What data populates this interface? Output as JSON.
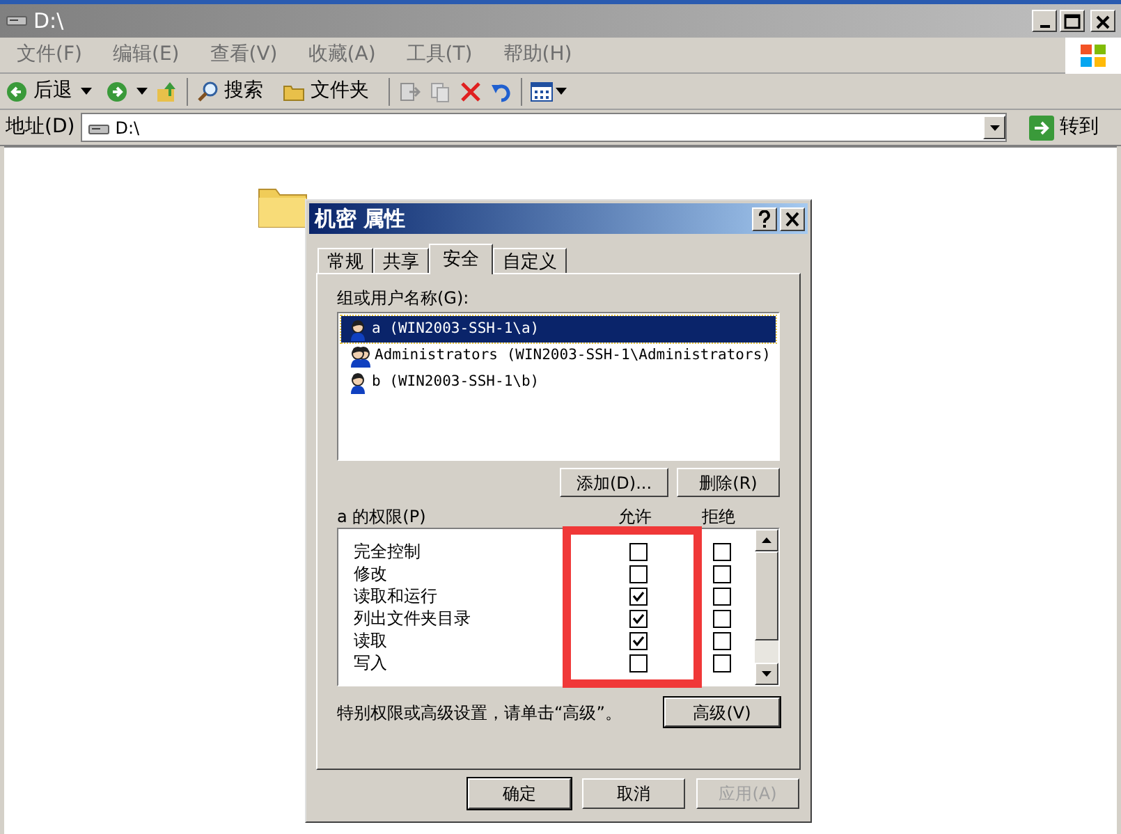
{
  "window": {
    "title": "D:\\"
  },
  "menu": [
    "文件(F)",
    "编辑(E)",
    "查看(V)",
    "收藏(A)",
    "工具(T)",
    "帮助(H)"
  ],
  "toolbar": {
    "back": "后退",
    "search": "搜索",
    "folders": "文件夹"
  },
  "address": {
    "label": "地址(D)",
    "value": "D:\\",
    "go": "转到"
  },
  "dialog": {
    "title": "机密 属性",
    "tabs": [
      {
        "label": "常规",
        "selected": false
      },
      {
        "label": "共享",
        "selected": false
      },
      {
        "label": "安全",
        "selected": true
      },
      {
        "label": "自定义",
        "selected": false
      }
    ],
    "users_label": "组或用户名称(G):",
    "users": [
      {
        "name": "a (WIN2003-SSH-1\\a)",
        "kind": "user",
        "selected": true
      },
      {
        "name": "Administrators (WIN2003-SSH-1\\Administrators)",
        "kind": "group",
        "selected": false
      },
      {
        "name": "b (WIN2003-SSH-1\\b)",
        "kind": "user",
        "selected": false
      }
    ],
    "add_button": "添加(D)...",
    "remove_button": "删除(R)",
    "permissions_label": "a 的权限(P)",
    "allow_header": "允许",
    "deny_header": "拒绝",
    "permissions": [
      {
        "name": "完全控制",
        "allow": false,
        "deny": false
      },
      {
        "name": "修改",
        "allow": false,
        "deny": false
      },
      {
        "name": "读取和运行",
        "allow": true,
        "deny": false
      },
      {
        "name": "列出文件夹目录",
        "allow": true,
        "deny": false
      },
      {
        "name": "读取",
        "allow": true,
        "deny": false
      },
      {
        "name": "写入",
        "allow": false,
        "deny": false
      }
    ],
    "advanced_hint": "特别权限或高级设置，请单击“高级”。",
    "advanced_button": "高级(V)",
    "buttons": [
      {
        "label": "确定",
        "disabled": false
      },
      {
        "label": "取消",
        "disabled": false
      },
      {
        "label": "应用(A)",
        "disabled": true
      }
    ]
  }
}
